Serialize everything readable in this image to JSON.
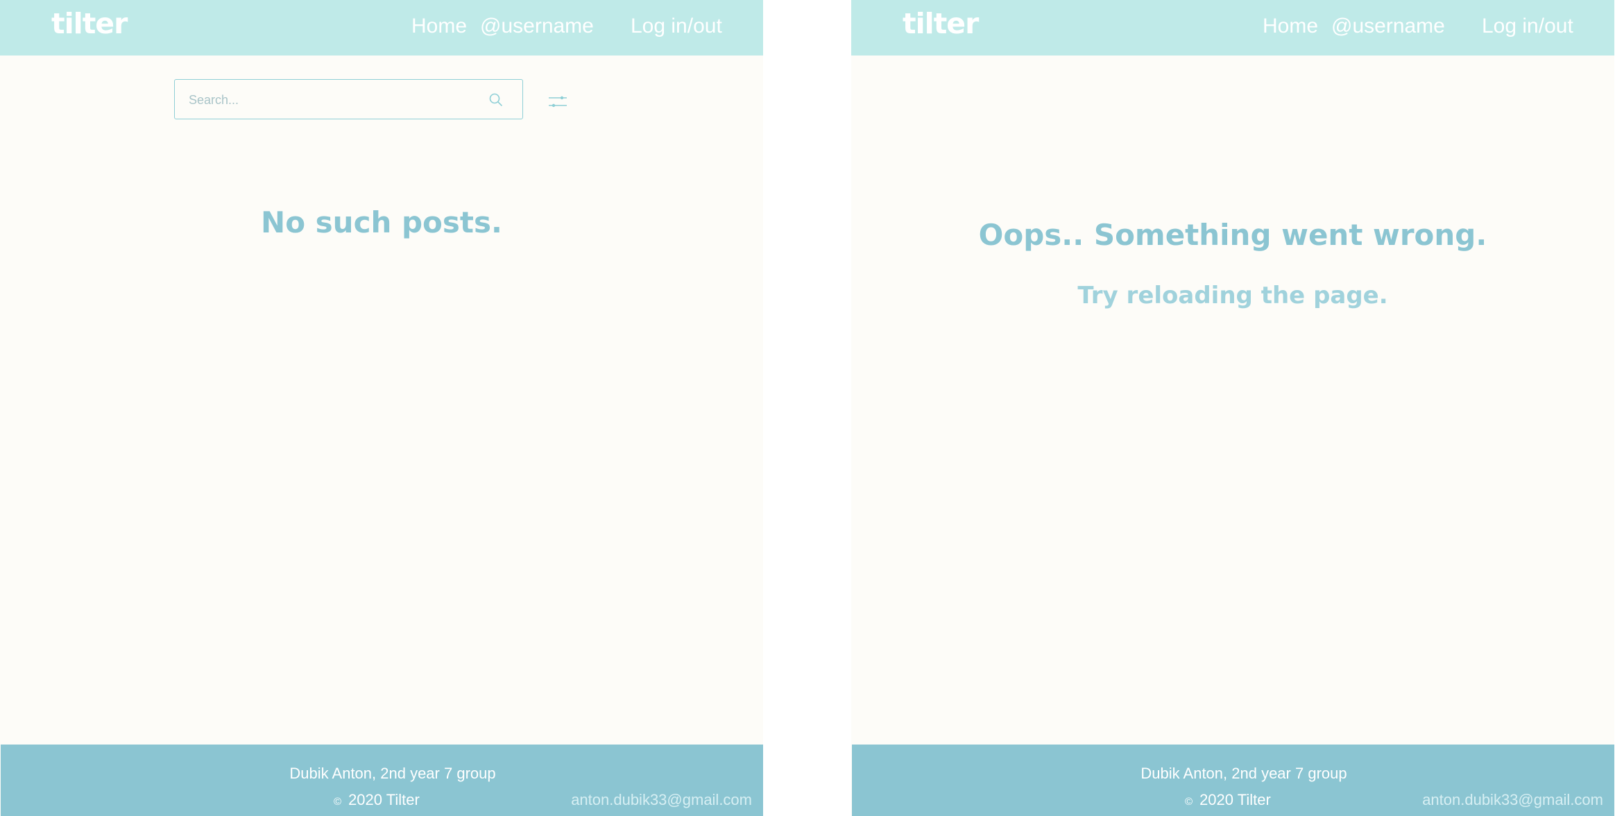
{
  "left": {
    "header": {
      "logo": "tilter",
      "nav_home": "Home",
      "nav_username": "@username",
      "nav_login": "Log in/out"
    },
    "search": {
      "placeholder": "Search...",
      "search_icon": "search-icon",
      "filter_icon": "sliders-icon"
    },
    "message": "No such posts.",
    "footer": {
      "author": "Dubik Anton, 2nd year 7 group",
      "copyright_symbol": "©",
      "copyright_text": "2020  Tilter",
      "email": "anton.dubik33@gmail.com"
    }
  },
  "right": {
    "header": {
      "logo": "tilter",
      "nav_home": "Home",
      "nav_username": "@username",
      "nav_login": "Log in/out"
    },
    "error_title": "Oops.. Something went wrong.",
    "error_subtitle": "Try reloading the page.",
    "footer": {
      "author": "Dubik Anton, 2nd year 7 group",
      "copyright_symbol": "©",
      "copyright_text": "2020  Tilter",
      "email": "anton.dubik33@gmail.com"
    }
  },
  "colors": {
    "header_bg": "#bfeae8",
    "page_bg": "#fdfcf8",
    "accent": "#8bc5d2",
    "footer_bg": "#8bc5d2"
  }
}
